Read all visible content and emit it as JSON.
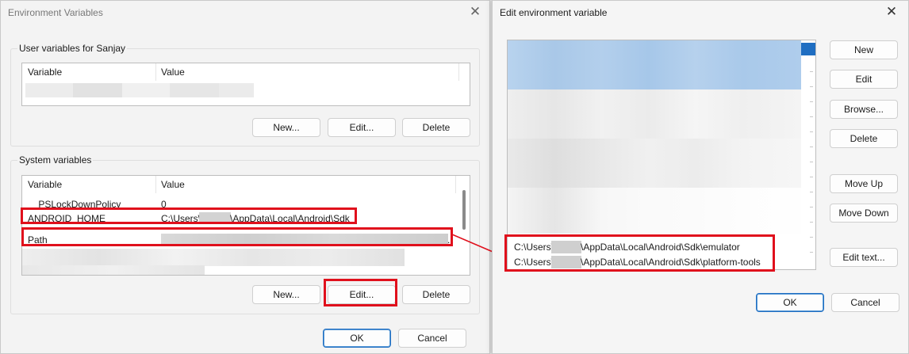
{
  "left_dialog": {
    "title": "Environment Variables",
    "close_glyph": "✕",
    "user_group": {
      "label": "User variables for Sanjay",
      "col_variable": "Variable",
      "col_value": "Value",
      "buttons": {
        "new": "New...",
        "edit": "Edit...",
        "delete": "Delete"
      }
    },
    "system_group": {
      "label": "System variables",
      "col_variable": "Variable",
      "col_value": "Value",
      "rows": [
        {
          "variable": "__PSLockDownPolicy",
          "value": "0"
        },
        {
          "variable": "ANDROID_HOME",
          "value_prefix": "C:\\Users\\",
          "value_suffix": "\\AppData\\Local\\Android\\Sdk"
        },
        {
          "variable": "Path",
          "value": "",
          "trailing": "."
        }
      ],
      "buttons": {
        "new": "New...",
        "edit": "Edit...",
        "delete": "Delete"
      }
    },
    "footer": {
      "ok": "OK",
      "cancel": "Cancel"
    }
  },
  "right_dialog": {
    "title": "Edit environment variable",
    "close_glyph": "✕",
    "entries": [
      {
        "prefix": "C:\\Users\\",
        "suffix": "\\AppData\\Local\\Android\\Sdk\\emulator"
      },
      {
        "prefix": "C:\\Users\\",
        "suffix": "\\AppData\\Local\\Android\\Sdk\\platform-tools"
      }
    ],
    "side_buttons": {
      "new": "New",
      "edit": "Edit",
      "browse": "Browse...",
      "delete": "Delete",
      "move_up": "Move Up",
      "move_down": "Move Down",
      "edit_text": "Edit text..."
    },
    "footer": {
      "ok": "OK",
      "cancel": "Cancel"
    }
  },
  "colors": {
    "highlight_red": "#e0101c",
    "selection_blue": "#a8cdef",
    "primary_border": "#1f6ec2"
  }
}
